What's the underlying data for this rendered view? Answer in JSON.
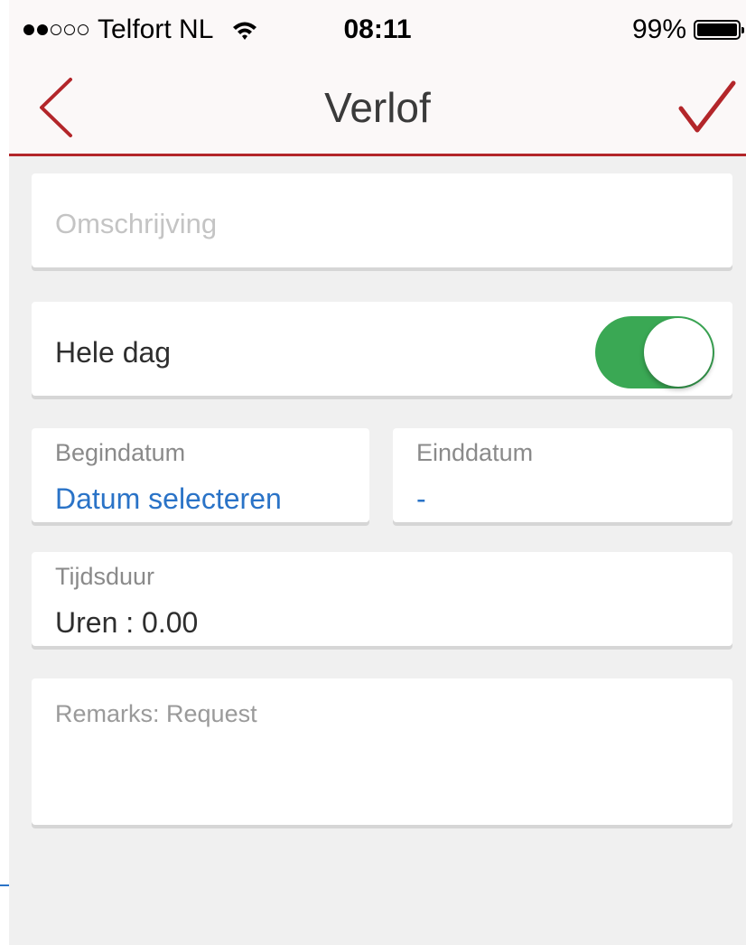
{
  "status_bar": {
    "carrier": "Telfort NL",
    "signal_bars": 2,
    "signal_total": 5,
    "time": "08:11",
    "battery_percent": "99%"
  },
  "nav": {
    "title": "Verlof",
    "back_icon": "chevron-left-icon",
    "confirm_icon": "checkmark-icon"
  },
  "form": {
    "description_placeholder": "Omschrijving",
    "whole_day_label": "Hele dag",
    "whole_day_enabled": true,
    "start_date_label": "Begindatum",
    "start_date_value": "Datum selecteren",
    "end_date_label": "Einddatum",
    "end_date_value": "-",
    "duration_label": "Tijdsduur",
    "duration_value": "Uren : 0.00",
    "remarks_placeholder": "Remarks: Request"
  },
  "colors": {
    "accent_red": "#b3262a",
    "toggle_green": "#3aa854",
    "link_blue": "#2a73c7",
    "background": "#f0f0f0"
  }
}
